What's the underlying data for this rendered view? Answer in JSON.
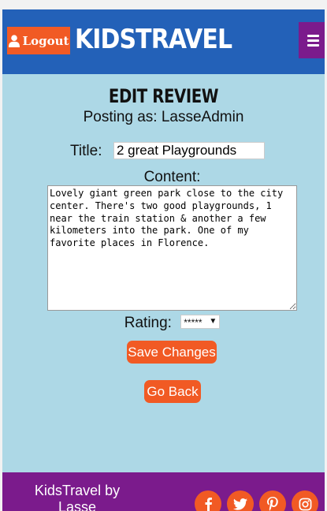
{
  "header": {
    "logout_label": "Logout",
    "brand": "KIDSTRAVEL",
    "menu_icon": "hamburger-icon"
  },
  "form": {
    "heading": "EDIT REVIEW",
    "posting_as": "Posting as: LasseAdmin",
    "title_label": "Title:",
    "title_value": "2 great Playgrounds",
    "content_label": "Content:",
    "content_value": "Lovely giant green park close to the city center. There's two good playgrounds, 1 near the train station & another a few kilometers into the park. One of my favorite places in Florence.",
    "rating_label": "Rating:",
    "rating_value": "*****",
    "save_label": "Save Changes",
    "back_label": "Go Back"
  },
  "footer": {
    "credit": "KidsTravel by Lasse Poulsen",
    "social": [
      "facebook-icon",
      "twitter-icon",
      "pinterest-icon",
      "instagram-icon"
    ]
  },
  "colors": {
    "header_bg": "#2361b8",
    "page_bg": "#add8e6",
    "accent": "#f15a24",
    "footer_bg": "#7b1b8c"
  }
}
